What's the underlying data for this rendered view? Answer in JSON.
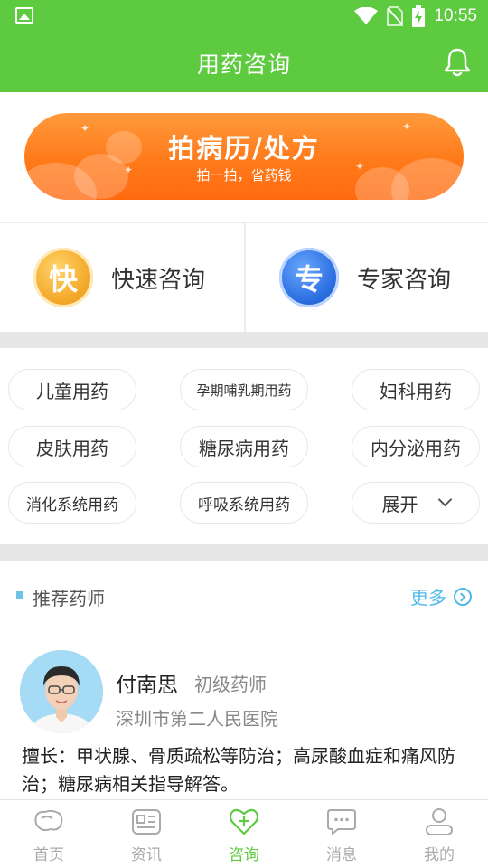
{
  "status_bar": {
    "time": "10:55"
  },
  "app_bar": {
    "title": "用药咨询",
    "bell_icon": "bell-icon"
  },
  "banner": {
    "title": "拍病历/处方",
    "subtitle": "拍一拍，省药钱"
  },
  "consult": {
    "fast": {
      "badge": "快",
      "label": "快速咨询"
    },
    "expert": {
      "badge": "专",
      "label": "专家咨询"
    }
  },
  "categories": [
    "儿童用药",
    "孕期哺乳期用药",
    "妇科用药",
    "皮肤用药",
    "糖尿病用药",
    "内分泌用药",
    "消化系统用药",
    "呼吸系统用药",
    "展开"
  ],
  "recommend": {
    "title": "推荐药师",
    "more_label": "更多"
  },
  "pharmacist": {
    "name": "付南思",
    "title": "初级药师",
    "hospital": "深圳市第二人民医院",
    "description": "擅长：甲状腺、骨质疏松等防治；高尿酸血症和痛风防治；糖尿病相关指导解答。"
  },
  "tabs": [
    {
      "label": "首页",
      "icon": "home-icon",
      "active": false
    },
    {
      "label": "资讯",
      "icon": "news-icon",
      "active": false
    },
    {
      "label": "咨询",
      "icon": "consult-icon",
      "active": true
    },
    {
      "label": "消息",
      "icon": "message-icon",
      "active": false
    },
    {
      "label": "我的",
      "icon": "profile-icon",
      "active": false
    }
  ],
  "colors": {
    "primary_green": "#5dca3f",
    "banner_orange": "#ff7a1a",
    "link_blue": "#4fb9e8"
  }
}
